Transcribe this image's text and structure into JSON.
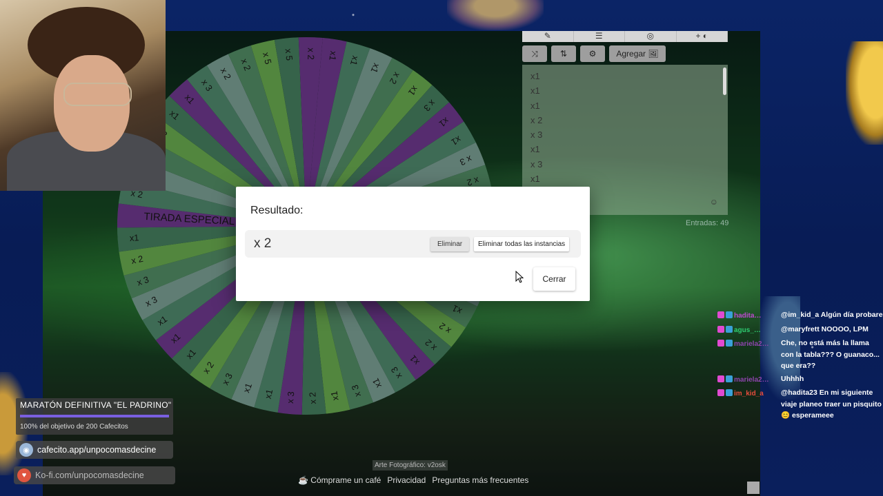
{
  "wheel": {
    "segments": [
      "x1",
      "x1",
      "x1",
      "x 2",
      "x1",
      "x 3",
      "x1",
      "x1",
      "x 3",
      "x 2",
      "x1",
      "x1",
      "TIRADA ESPECIAL",
      "x1",
      "x1",
      "x1",
      "x 2",
      "x 2",
      "x1",
      "x 3",
      "x1",
      "x 3",
      "x1",
      "x 2",
      "x 3",
      "x1",
      "x1",
      "x 3",
      "x 2",
      "x1",
      "x1",
      "x1",
      "x 3",
      "x 3",
      "x 2",
      "x1",
      "TIRADA ESPECIAL",
      "x 2",
      "x 3",
      "x1",
      "x 2",
      "x1",
      "x1",
      "x 3",
      "x 2",
      "x 2",
      "x 5",
      "x 5",
      "x 2"
    ],
    "colors": [
      "#7b3fa0",
      "#5a9a7a",
      "#8ab4a6",
      "#5c9e72",
      "#76c05a",
      "#4e8f6a"
    ]
  },
  "panel": {
    "toolbar_icons": [
      "pencil-icon",
      "list-icon",
      "eye-slash-icon",
      "add-image-icon"
    ],
    "shuffle_label": "⤨",
    "sort_label": "⇅",
    "settings_label": "⚙",
    "add_label": "Agregar 🖼",
    "entries": [
      "x1",
      "x1",
      "x1",
      "x 2",
      "x 3",
      "x1",
      "x 3",
      "x1"
    ],
    "emoji": "☺",
    "count": "Entradas: 49"
  },
  "modal": {
    "title": "Resultado:",
    "value": "x 2",
    "remove_label": "Eliminar",
    "remove_all_label": "Eliminar todas las instancias",
    "close_label": "Cerrar"
  },
  "footer": {
    "coffee": "☕ Cómprame un café",
    "privacy": "Privacidad",
    "faq": "Preguntas más frecuentes",
    "credit": "Arte Fotográfico: v2osk"
  },
  "goal": {
    "title": "MARATÓN DEFINITIVA \"EL PADRINO\"",
    "progress": 1.0,
    "subtitle": "100% del objetivo de 200 Cafecitos",
    "fill_color": "#7a5fe0"
  },
  "links": {
    "cafecito": "cafecito.app/unpocomasdecine",
    "kofi": "Ko-fi.com/unpocomasdecine"
  },
  "chat": [
    {
      "name": "hadita…",
      "color": "#c04ad1",
      "text": "@im_kid_a Algún día probare"
    },
    {
      "name": "agus_…",
      "color": "#2ecc71",
      "text": "@maryfrett NOOOO, LPM"
    },
    {
      "name": "mariela2…",
      "color": "#8e44ad",
      "text": "Che, no está más la llama con la tabla??? O guanaco... que era??"
    },
    {
      "name": "mariela2…",
      "color": "#8e44ad",
      "text": "Uhhhh"
    },
    {
      "name": "im_kid_a",
      "color": "#e74c3c",
      "text": "@hadita23 En mi siguiente viaje planeo traer un pisquito 😊 esperameee"
    }
  ]
}
